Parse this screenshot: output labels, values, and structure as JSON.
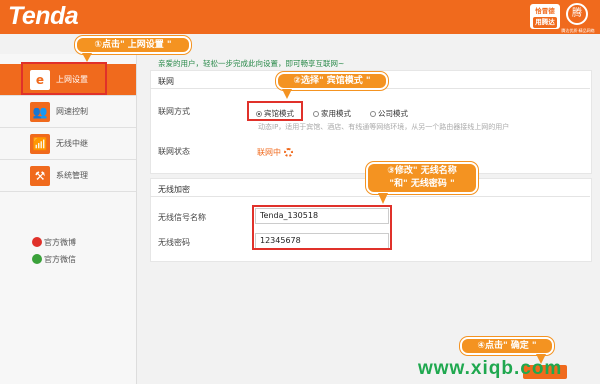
{
  "header": {
    "logo": "Tenda",
    "badge_line1": "恰冒德",
    "badge_line2": "用腾达",
    "brand_caption": "腾达优质·精品网络",
    "brand_symbol": "腾"
  },
  "sidebar": {
    "items": [
      {
        "label": "上网设置",
        "icon": "e"
      },
      {
        "label": "网速控制",
        "icon": "👥"
      },
      {
        "label": "无线中继",
        "icon": "📶"
      },
      {
        "label": "系统管理",
        "icon": "⚒"
      }
    ],
    "social": [
      {
        "label": "官方微博"
      },
      {
        "label": "官方微信"
      }
    ]
  },
  "main": {
    "intro": "亲爱的用户，轻松一步完成此向设置，即可畅享互联网~",
    "internet_section": "联网",
    "connect_mode_label": "联网方式",
    "modes": [
      "宾馆模式",
      "家用模式",
      "公司模式"
    ],
    "selected_mode": "宾馆模式",
    "hint": "动态IP，适用于宾馆、酒店、有线通等网络环境，从另一个路由器接线上网的用户",
    "status_label": "联网状态",
    "status_value": "联网中",
    "wireless_section": "无线加密",
    "ssid_label": "无线信号名称",
    "ssid_value": "Tenda_130518",
    "password_label": "无线密码",
    "password_value": "12345678"
  },
  "callouts": {
    "step1": "①点击\" 上网设置 \"",
    "step2": "②选择\" 宾馆模式 \"",
    "step3_line1": "③修改\" 无线名称",
    "step3_line2": "\"和\" 无线密码 \"",
    "step4": "④点击\" 确定 \""
  },
  "watermark": "www.xiqb.com",
  "colors": {
    "brand": "#f06a1d",
    "callout": "#f49321",
    "highlight": "#e0312a",
    "watermark": "#1fa84f"
  }
}
